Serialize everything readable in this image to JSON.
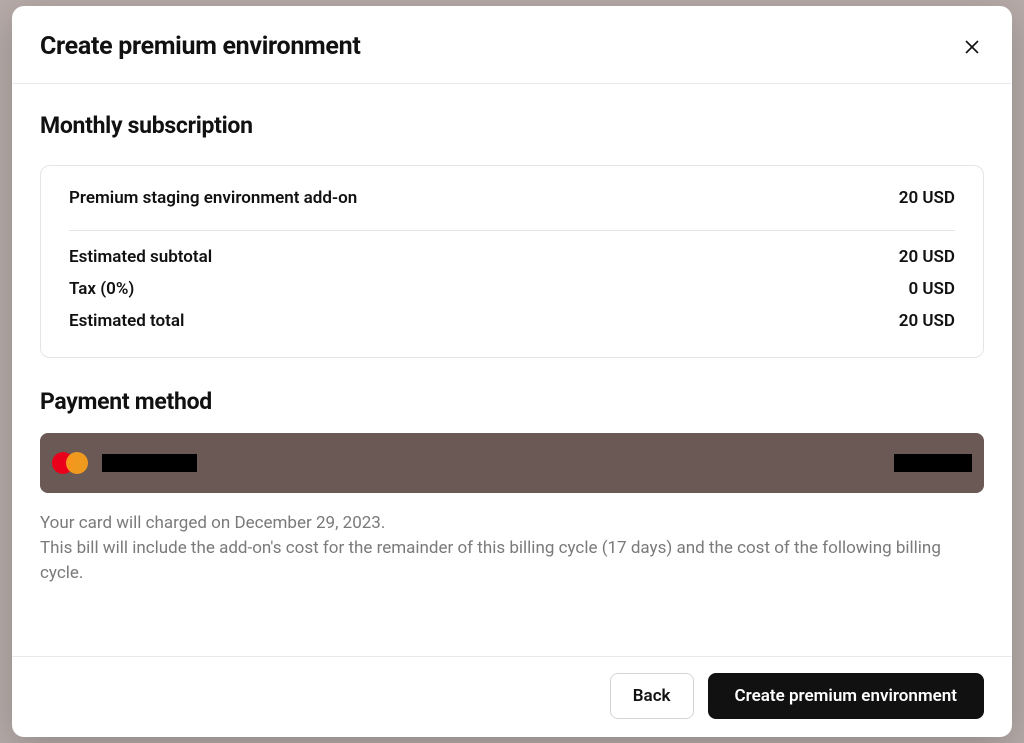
{
  "header": {
    "title": "Create premium environment"
  },
  "subscription": {
    "heading": "Monthly subscription",
    "item_label": "Premium staging environment add-on",
    "item_price": "20 USD",
    "subtotal_label": "Estimated subtotal",
    "subtotal_value": "20 USD",
    "tax_label": "Tax (0%)",
    "tax_value": "0 USD",
    "total_label": "Estimated total",
    "total_value": "20 USD"
  },
  "payment": {
    "heading": "Payment method",
    "card_brand": "mastercard",
    "note": "Your card will charged on December 29, 2023.\nThis bill will include the add-on's cost for the remainder of this billing cycle (17 days) and the cost of the following billing cycle."
  },
  "footer": {
    "back_label": "Back",
    "submit_label": "Create premium environment"
  }
}
